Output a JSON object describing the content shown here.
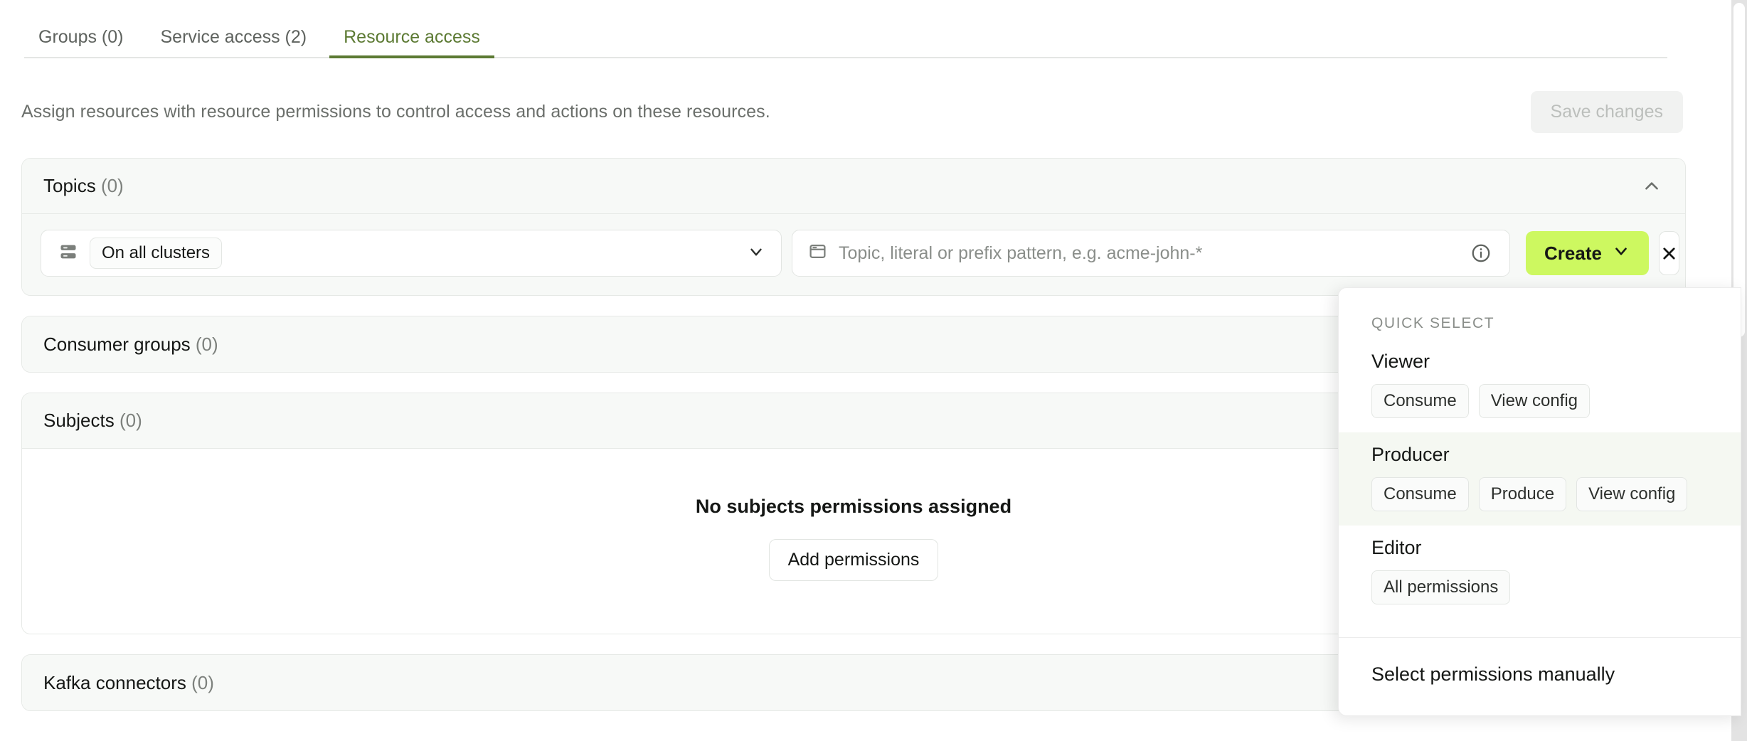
{
  "tabs": [
    {
      "label": "Groups (0)",
      "active": false
    },
    {
      "label": "Service access (2)",
      "active": false
    },
    {
      "label": "Resource access",
      "active": true
    }
  ],
  "header": {
    "description": "Assign resources with resource permissions to control access and actions on these resources.",
    "save_label": "Save changes"
  },
  "panels": {
    "topics": {
      "title": "Topics",
      "count": "(0)",
      "cluster_chip": "On all clusters",
      "topic_placeholder": "Topic, literal or prefix pattern, e.g. acme-john-*",
      "create_label": "Create"
    },
    "consumer_groups": {
      "title": "Consumer groups",
      "count": "(0)"
    },
    "subjects": {
      "title": "Subjects",
      "count": "(0)",
      "empty_title": "No subjects permissions assigned",
      "empty_button": "Add permissions"
    },
    "kafka_connectors": {
      "title": "Kafka connectors",
      "count": "(0)"
    }
  },
  "quick_select": {
    "label": "QUICK SELECT",
    "groups": [
      {
        "title": "Viewer",
        "highlight": false,
        "chips": [
          "Consume",
          "View config"
        ]
      },
      {
        "title": "Producer",
        "highlight": true,
        "chips": [
          "Consume",
          "Produce",
          "View config"
        ]
      },
      {
        "title": "Editor",
        "highlight": false,
        "chips": [
          "All permissions"
        ]
      }
    ],
    "manual_label": "Select permissions manually"
  },
  "colors": {
    "accent_green": "#5c7a33",
    "create_lime": "#cdf860",
    "panel_head_bg": "#f7f9f7",
    "highlight_bg": "#f5f8f2"
  }
}
